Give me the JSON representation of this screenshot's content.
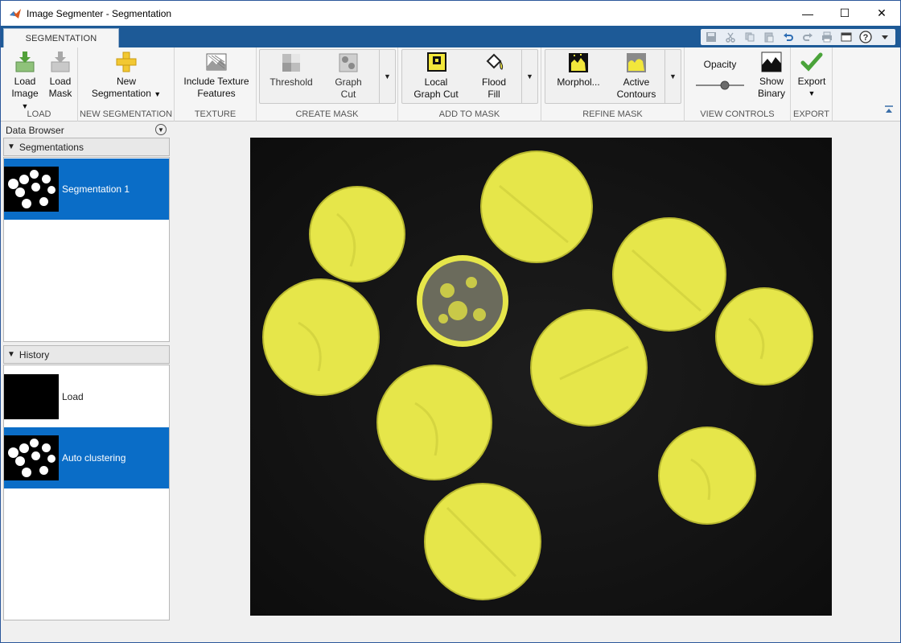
{
  "window": {
    "title": "Image Segmenter - Segmentation"
  },
  "titlebar_buttons": {
    "minimize": "—",
    "maximize": "☐",
    "close": "✕"
  },
  "tabs": [
    {
      "label": "SEGMENTATION"
    }
  ],
  "ribbon": {
    "load": {
      "label": "LOAD",
      "load_image": [
        "Load",
        "Image"
      ],
      "load_mask": [
        "Load",
        "Mask"
      ]
    },
    "new_segmentation": {
      "label": "NEW SEGMENTATION",
      "button": [
        "New",
        "Segmentation"
      ]
    },
    "texture": {
      "label": "TEXTURE",
      "button": [
        "Include Texture",
        "Features"
      ]
    },
    "create_mask": {
      "label": "CREATE MASK",
      "threshold": "Threshold",
      "graph_cut": [
        "Graph",
        "Cut"
      ]
    },
    "add_to_mask": {
      "label": "ADD TO MASK",
      "local_graph_cut": [
        "Local",
        "Graph Cut"
      ],
      "flood_fill": [
        "Flood",
        "Fill"
      ]
    },
    "refine_mask": {
      "label": "REFINE MASK",
      "morphology": "Morphol...",
      "active_contours": [
        "Active",
        "Contours"
      ]
    },
    "view_controls": {
      "label": "VIEW CONTROLS",
      "opacity": "Opacity",
      "show_binary": [
        "Show",
        "Binary"
      ]
    },
    "export": {
      "label": "EXPORT",
      "button": "Export"
    }
  },
  "data_browser": {
    "title": "Data Browser",
    "segmentations_header": "Segmentations",
    "segmentations": [
      {
        "label": "Segmentation 1"
      }
    ],
    "history_header": "History",
    "history": [
      {
        "label": "Load"
      },
      {
        "label": "Auto clustering"
      }
    ]
  },
  "colors": {
    "accent": "#0a6dc7",
    "tab_strip": "#1d5a97",
    "mask_overlay": "#e6e64a"
  }
}
